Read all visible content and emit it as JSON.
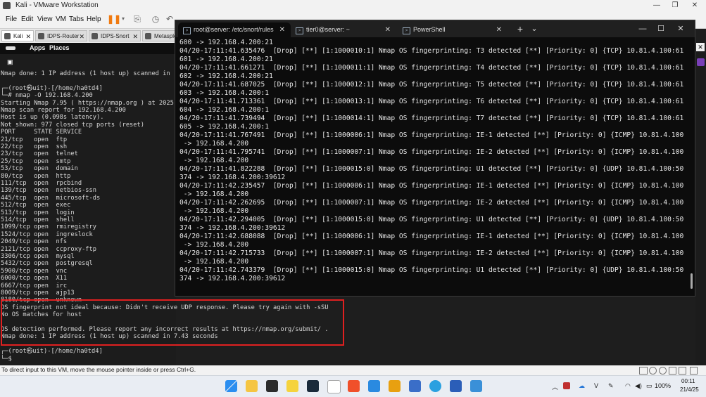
{
  "vmware": {
    "title": "Kali - VMware Workstation",
    "menus": [
      "File",
      "Edit",
      "View",
      "VM",
      "Tabs",
      "Help"
    ],
    "tabs": [
      "Kali",
      "IDPS-Router",
      "IDPS-Snort",
      "Metasploit"
    ]
  },
  "kali_panel": {
    "apps": "Apps",
    "places": "Places"
  },
  "kali_terminal": {
    "lines": [
      "Nmap done: 1 IP address (1 host up) scanned in",
      "",
      "┌─(root㉿uit)-[/home/ha0td4]",
      "└─# nmap -O 192.168.4.200",
      "Starting Nmap 7.95 ( https://nmap.org ) at 2025",
      "Nmap scan report for 192.168.4.200",
      "Host is up (0.098s latency).",
      "Not shown: 977 closed tcp ports (reset)",
      "PORT     STATE SERVICE",
      "21/tcp   open  ftp",
      "22/tcp   open  ssh",
      "23/tcp   open  telnet",
      "25/tcp   open  smtp",
      "53/tcp   open  domain",
      "80/tcp   open  http",
      "111/tcp  open  rpcbind",
      "139/tcp  open  netbios-ssn",
      "445/tcp  open  microsoft-ds",
      "512/tcp  open  exec",
      "513/tcp  open  login",
      "514/tcp  open  shell",
      "1099/tcp open  rmiregistry",
      "1524/tcp open  ingreslock",
      "2049/tcp open  nfs",
      "2121/tcp open  ccproxy-ftp",
      "3306/tcp open  mysql",
      "5432/tcp open  postgresql",
      "5900/tcp open  vnc",
      "6000/tcp open  X11",
      "6667/tcp open  irc",
      "8009/tcp open  ajp13",
      "8180/tcp open  unknown",
      "OS fingerprint not ideal because: Didn't receive UDP response. Please try again with -sSU",
      "No OS matches for host",
      "",
      "OS detection performed. Please report any incorrect results at https://nmap.org/submit/ .",
      "Nmap done: 1 IP address (1 host up) scanned in 7.43 seconds",
      "",
      "┌─(root㉿uit)-[/home/ha0td4]",
      "└─$ "
    ]
  },
  "windows_terminal": {
    "tabs": [
      {
        "label": "root@server: /etc/snort/rules"
      },
      {
        "label": "tier0@server: ~"
      },
      {
        "label": "PowerShell"
      }
    ],
    "new_tab": "+",
    "dropdown": "⌄",
    "lines": [
      "600 -> 192.168.4.200:21",
      "04/20-17:11:41.635476  [Drop] [**] [1:1000010:1] Nmap OS fingerprinting: T3 detected [**] [Priority: 0] {TCP} 10.81.4.100:61",
      "601 -> 192.168.4.200:21",
      "04/20-17:11:41.661271  [Drop] [**] [1:1000011:1] Nmap OS fingerprinting: T4 detected [**] [Priority: 0] {TCP} 10.81.4.100:61",
      "602 -> 192.168.4.200:21",
      "04/20-17:11:41.687025  [Drop] [**] [1:1000012:1] Nmap OS fingerprinting: T5 detected [**] [Priority: 0] {TCP} 10.81.4.100:61",
      "603 -> 192.168.4.200:1",
      "04/20-17:11:41.713361  [Drop] [**] [1:1000013:1] Nmap OS fingerprinting: T6 detected [**] [Priority: 0] {TCP} 10.81.4.100:61",
      "604 -> 192.168.4.200:1",
      "04/20-17:11:41.739494  [Drop] [**] [1:1000014:1] Nmap OS fingerprinting: T7 detected [**] [Priority: 0] {TCP} 10.81.4.100:61",
      "605 -> 192.168.4.200:1",
      "04/20-17:11:41.767491  [Drop] [**] [1:1000006:1] Nmap OS fingerprinting: IE-1 detected [**] [Priority: 0] {ICMP} 10.81.4.100",
      " -> 192.168.4.200",
      "04/20-17:11:41.795741  [Drop] [**] [1:1000007:1] Nmap OS fingerprinting: IE-2 detected [**] [Priority: 0] {ICMP} 10.81.4.100",
      " -> 192.168.4.200",
      "04/20-17:11:41.822288  [Drop] [**] [1:1000015:0] Nmap OS fingerprinting: U1 detected [**] [Priority: 0] {UDP} 10.81.4.100:50",
      "374 -> 192.168.4.200:39612",
      "04/20-17:11:42.235457  [Drop] [**] [1:1000006:1] Nmap OS fingerprinting: IE-1 detected [**] [Priority: 0] {ICMP} 10.81.4.100",
      " -> 192.168.4.200",
      "04/20-17:11:42.262695  [Drop] [**] [1:1000007:1] Nmap OS fingerprinting: IE-2 detected [**] [Priority: 0] {ICMP} 10.81.4.100",
      " -> 192.168.4.200",
      "04/20-17:11:42.294005  [Drop] [**] [1:1000015:0] Nmap OS fingerprinting: U1 detected [**] [Priority: 0] {UDP} 10.81.4.100:50",
      "374 -> 192.168.4.200:39612",
      "04/20-17:11:42.688088  [Drop] [**] [1:1000006:1] Nmap OS fingerprinting: IE-1 detected [**] [Priority: 0] {ICMP} 10.81.4.100",
      " -> 192.168.4.200",
      "04/20-17:11:42.715733  [Drop] [**] [1:1000007:1] Nmap OS fingerprinting: IE-2 detected [**] [Priority: 0] {ICMP} 10.81.4.100",
      " -> 192.168.4.200",
      "04/20-17:11:42.743379  [Drop] [**] [1:1000015:0] Nmap OS fingerprinting: U1 detected [**] [Priority: 0] {UDP} 10.81.4.100:50",
      "374 -> 192.168.4.200:39612"
    ]
  },
  "status_bar": {
    "text": "To direct input to this VM, move the mouse pointer inside or press Ctrl+G."
  },
  "taskbar": {
    "battery": "100%",
    "time": "00:11",
    "date": "21/4/25",
    "icons": [
      "windows-start-icon",
      "file-explorer-icon",
      "terminal-icon",
      "sticky-notes-icon",
      "app-icon",
      "app-icon",
      "brave-browser-icon",
      "vscode-icon",
      "app-icon",
      "app-icon",
      "telegram-icon",
      "word-icon",
      "photos-icon"
    ]
  },
  "colors": {
    "highlight": "#e02020",
    "prompt": "#3c6dd4",
    "terminal_bg": "#0c0c0c"
  }
}
